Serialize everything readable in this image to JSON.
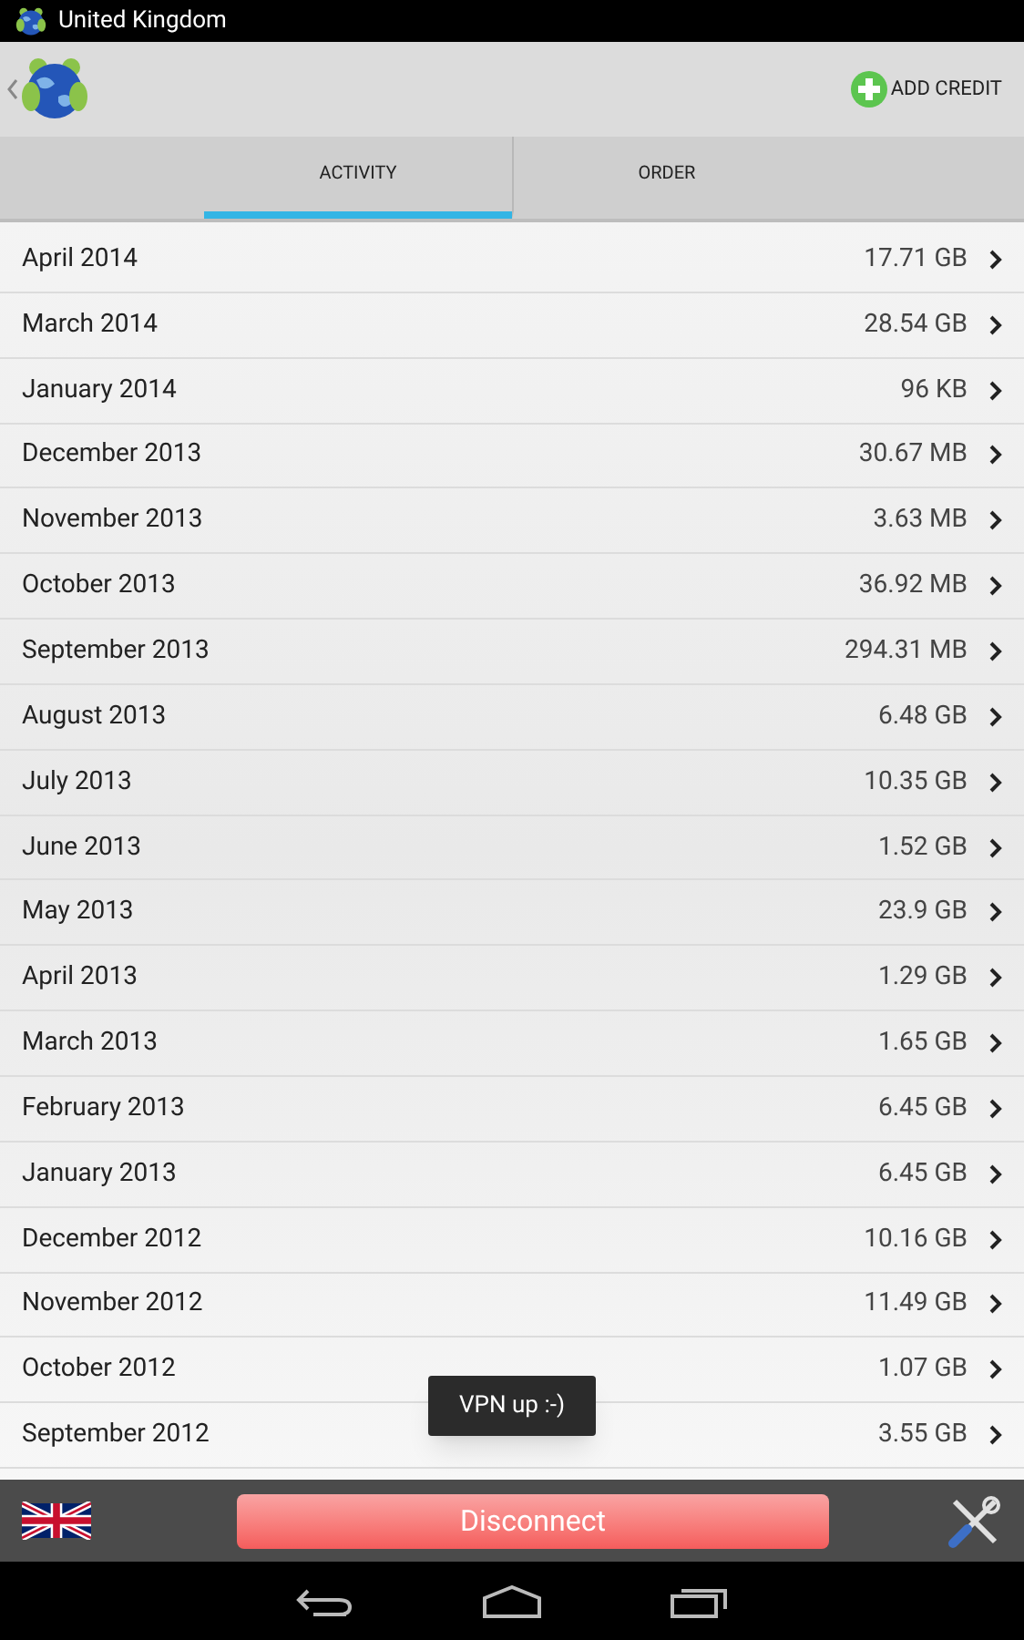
{
  "status_bar": {
    "title": "United Kingdom"
  },
  "action_bar": {
    "add_credit": "ADD CREDIT"
  },
  "tabs": [
    {
      "label": "ACTIVITY",
      "selected": true
    },
    {
      "label": "ORDER",
      "selected": false
    }
  ],
  "rows": [
    {
      "month": "April 2014",
      "usage": "17.71 GB"
    },
    {
      "month": "March 2014",
      "usage": "28.54 GB"
    },
    {
      "month": "January 2014",
      "usage": "96 KB"
    },
    {
      "month": "December 2013",
      "usage": "30.67 MB"
    },
    {
      "month": "November 2013",
      "usage": "3.63 MB"
    },
    {
      "month": "October 2013",
      "usage": "36.92 MB"
    },
    {
      "month": "September 2013",
      "usage": "294.31 MB"
    },
    {
      "month": "August 2013",
      "usage": "6.48 GB"
    },
    {
      "month": "July 2013",
      "usage": "10.35 GB"
    },
    {
      "month": "June 2013",
      "usage": "1.52 GB"
    },
    {
      "month": "May 2013",
      "usage": "23.9 GB"
    },
    {
      "month": "April 2013",
      "usage": "1.29 GB"
    },
    {
      "month": "March 2013",
      "usage": "1.65 GB"
    },
    {
      "month": "February 2013",
      "usage": "6.45 GB"
    },
    {
      "month": "January 2013",
      "usage": "6.45 GB"
    },
    {
      "month": "December 2012",
      "usage": "10.16 GB"
    },
    {
      "month": "November 2012",
      "usage": "11.49 GB"
    },
    {
      "month": "October 2012",
      "usage": "1.07 GB"
    },
    {
      "month": "September 2012",
      "usage": "3.55 GB"
    }
  ],
  "toast": "VPN up :-)",
  "bottom_bar": {
    "button": "Disconnect"
  }
}
